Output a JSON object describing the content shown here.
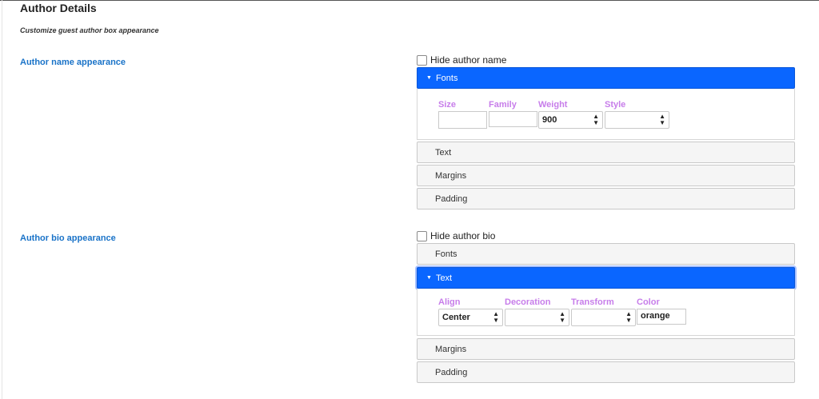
{
  "page": {
    "title": "Author Details",
    "subtitle": "Customize guest author box appearance"
  },
  "author_name": {
    "section_label": "Author name appearance",
    "hide_checkbox_label": "Hide author name",
    "hide_checked": false,
    "accordion": {
      "fonts_label": "Fonts",
      "text_label": "Text",
      "margins_label": "Margins",
      "padding_label": "Padding"
    },
    "fonts": {
      "size_label": "Size",
      "family_label": "Family",
      "weight_label": "Weight",
      "style_label": "Style",
      "size_value": "",
      "family_value": "",
      "weight_value": "900",
      "style_value": ""
    }
  },
  "author_bio": {
    "section_label": "Author bio appearance",
    "hide_checkbox_label": "Hide author bio",
    "hide_checked": false,
    "accordion": {
      "fonts_label": "Fonts",
      "text_label": "Text",
      "margins_label": "Margins",
      "padding_label": "Padding"
    },
    "text": {
      "align_label": "Align",
      "decoration_label": "Decoration",
      "transform_label": "Transform",
      "color_label": "Color",
      "align_value": "Center",
      "decoration_value": "",
      "transform_value": "",
      "color_value": "orange"
    }
  },
  "icons": {
    "caret": "caret-down-icon",
    "select_arrows": "updown-arrows-icon"
  },
  "colors": {
    "accent": "#0a66ff",
    "section_label": "#1a73c8",
    "field_label": "#c77dea"
  }
}
